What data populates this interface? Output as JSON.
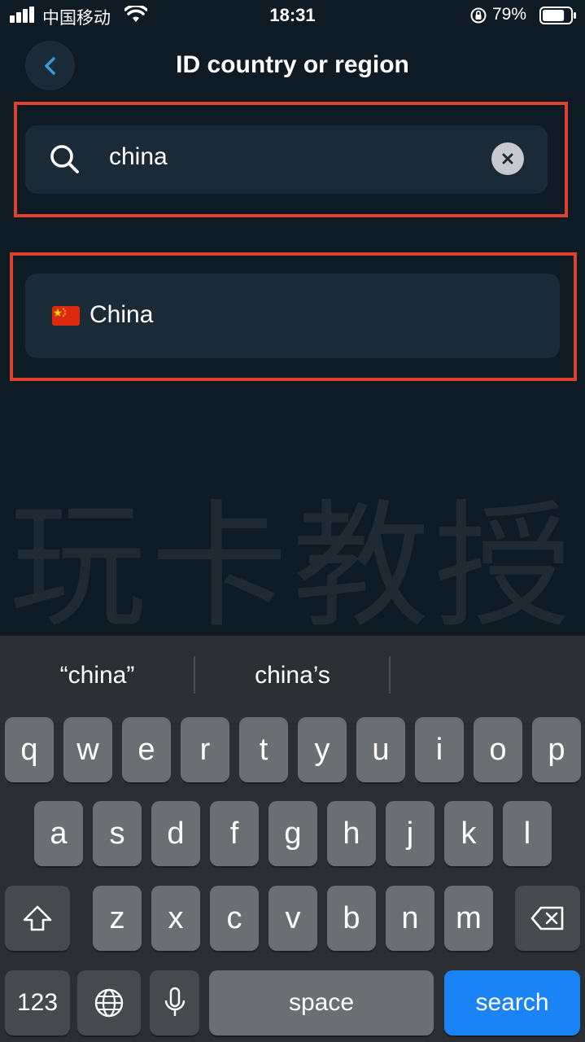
{
  "status_bar": {
    "carrier": "中国移动",
    "time": "18:31",
    "battery_percent": "79%",
    "battery_level": 0.79
  },
  "header": {
    "title": "ID country or region",
    "back_icon": "chevron-left-icon"
  },
  "search": {
    "value": "china",
    "icon": "search-icon",
    "clear_icon": "close-icon"
  },
  "results": [
    {
      "flag": "china-flag-icon",
      "label": "China"
    }
  ],
  "watermark": "玩卡教授",
  "colors": {
    "background": "#0e1a24",
    "card": "#1a2a37",
    "highlight_border": "#e0402e",
    "accent": "#1a84f6"
  },
  "keyboard": {
    "suggestions": [
      "“china”",
      "china’s"
    ],
    "row1": [
      "q",
      "w",
      "e",
      "r",
      "t",
      "y",
      "u",
      "i",
      "o",
      "p"
    ],
    "row2": [
      "a",
      "s",
      "d",
      "f",
      "g",
      "h",
      "j",
      "k",
      "l"
    ],
    "row3": [
      "z",
      "x",
      "c",
      "v",
      "b",
      "n",
      "m"
    ],
    "numbers_key": "123",
    "space_key": "space",
    "search_key": "search"
  }
}
